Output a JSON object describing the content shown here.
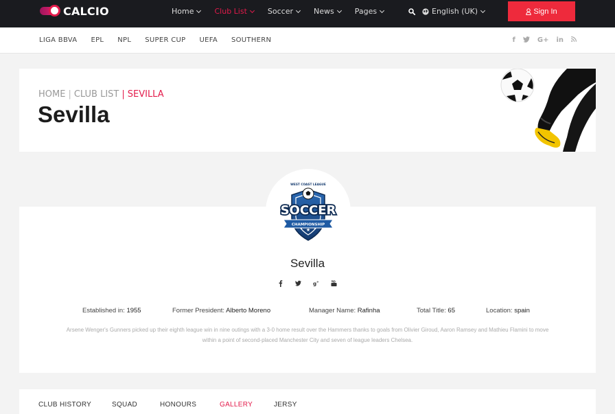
{
  "brand": {
    "name": "CALCIO"
  },
  "nav": {
    "items": [
      {
        "label": "Home",
        "active": false
      },
      {
        "label": "Club List",
        "active": true
      },
      {
        "label": "Soccer",
        "active": false
      },
      {
        "label": "News",
        "active": false
      },
      {
        "label": "Pages",
        "active": false
      }
    ],
    "language": "English (UK)",
    "sign_in": "Sign In"
  },
  "subnav": {
    "items": [
      "LIGA BBVA",
      "EPL",
      "NPL",
      "SUPER CUP",
      "UEFA",
      "SOUTHERN"
    ],
    "socials": [
      "facebook-icon",
      "twitter-icon",
      "google-plus-icon",
      "linkedin-icon",
      "rss-icon"
    ]
  },
  "hero": {
    "breadcrumb": {
      "home": "HOME",
      "list": "CLUB LIST",
      "current": "SEVILLA",
      "sep1": "|",
      "sep2": "|"
    },
    "title": "Sevilla"
  },
  "club": {
    "crest_text_top": "WEST COAST LEAGUE",
    "crest_text_main": "SOCCER",
    "crest_text_ribbon": "CHAMPIONSHIP",
    "name": "Sevilla",
    "socials": [
      "facebook-icon",
      "twitter-icon",
      "google-plus-icon",
      "youtube-icon"
    ],
    "facts": {
      "established_label": "Established in:",
      "established_value": "1955",
      "president_label": "Former President:",
      "president_value": "Alberto Moreno",
      "manager_label": "Manager Name:",
      "manager_value": "Rafinha",
      "titles_label": "Total Title:",
      "titles_value": "65",
      "location_label": "Location:",
      "location_value": "spain"
    },
    "description": "Arsene Wenger's Gunners picked up their eighth league win in nine outings with a 3-0 home result over the Hammers thanks to goals from Olivier Giroud, Aaron Ramsey and Mathieu Flamini to move within a point of second-placed Manchester City and seven of league leaders Chelsea."
  },
  "tabs": [
    {
      "label": "CLUB HISTORY",
      "active": false
    },
    {
      "label": "SQUAD",
      "active": false
    },
    {
      "label": "HONOURS",
      "active": false
    },
    {
      "label": "GALLERY",
      "active": true
    },
    {
      "label": "JERSY",
      "active": false
    }
  ],
  "colors": {
    "accent": "#e31b4b",
    "topbar": "#1a1b1f",
    "signin": "#ee2a3c"
  }
}
